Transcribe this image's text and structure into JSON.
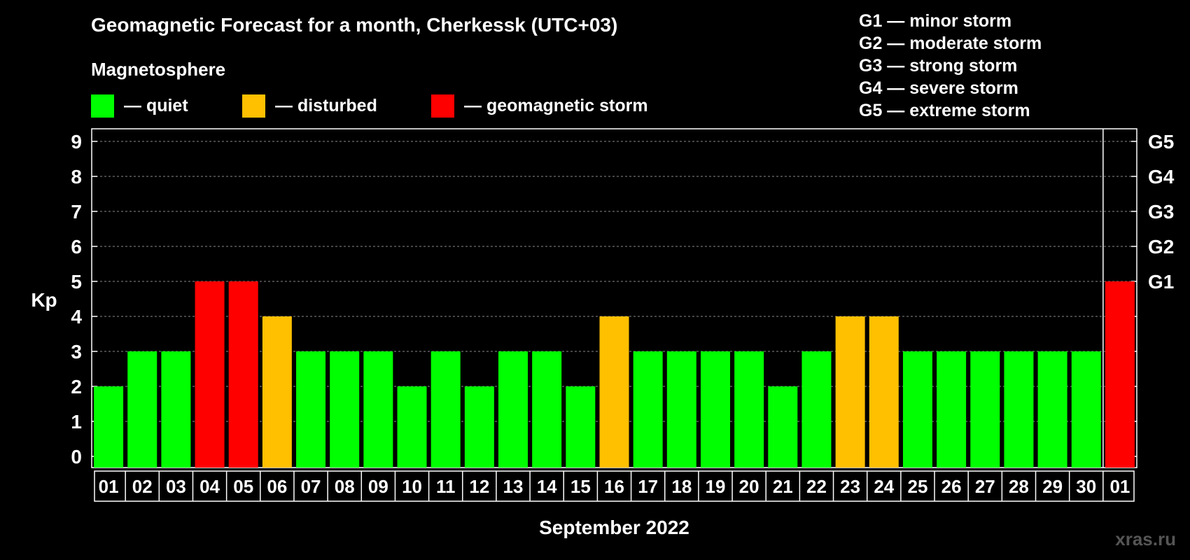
{
  "title": "Geomagnetic Forecast for a month, Cherkessk (UTC+03)",
  "subtitle": "Magnetosphere",
  "legend": [
    {
      "label": "— quiet",
      "color": "#00ff00"
    },
    {
      "label": "— disturbed",
      "color": "#ffc000"
    },
    {
      "label": "— geomagnetic storm",
      "color": "#ff0000"
    }
  ],
  "g_scale": [
    "G1 — minor storm",
    "G2 — moderate storm",
    "G3 — strong storm",
    "G4 — severe storm",
    "G5 — extreme storm"
  ],
  "watermark": "xras.ru",
  "chart_data": {
    "type": "bar",
    "title": "Geomagnetic Forecast for a month, Cherkessk (UTC+03)",
    "xlabel": "September 2022",
    "ylabel": "Kp",
    "ylim": [
      0,
      9
    ],
    "yticks": [
      "0",
      "1",
      "2",
      "3",
      "4",
      "5",
      "6",
      "7",
      "8",
      "9"
    ],
    "right_ticks": [
      {
        "kp": 5,
        "label": "G1"
      },
      {
        "kp": 6,
        "label": "G2"
      },
      {
        "kp": 7,
        "label": "G3"
      },
      {
        "kp": 8,
        "label": "G4"
      },
      {
        "kp": 9,
        "label": "G5"
      }
    ],
    "grid": true,
    "categories": [
      "01",
      "02",
      "03",
      "04",
      "05",
      "06",
      "07",
      "08",
      "09",
      "10",
      "11",
      "12",
      "13",
      "14",
      "15",
      "16",
      "17",
      "18",
      "19",
      "20",
      "21",
      "22",
      "23",
      "24",
      "25",
      "26",
      "27",
      "28",
      "29",
      "30",
      "01"
    ],
    "values": [
      2,
      3,
      3,
      5,
      5,
      4,
      3,
      3,
      3,
      2,
      3,
      2,
      3,
      3,
      2,
      4,
      3,
      3,
      3,
      3,
      2,
      3,
      4,
      4,
      3,
      3,
      3,
      3,
      3,
      3,
      5
    ],
    "status": [
      "quiet",
      "quiet",
      "quiet",
      "storm",
      "storm",
      "disturbed",
      "quiet",
      "quiet",
      "quiet",
      "quiet",
      "quiet",
      "quiet",
      "quiet",
      "quiet",
      "quiet",
      "disturbed",
      "quiet",
      "quiet",
      "quiet",
      "quiet",
      "quiet",
      "quiet",
      "disturbed",
      "disturbed",
      "quiet",
      "quiet",
      "quiet",
      "quiet",
      "quiet",
      "quiet",
      "storm"
    ],
    "colors": {
      "quiet": "#00ff00",
      "disturbed": "#ffc000",
      "storm": "#ff0000"
    }
  }
}
